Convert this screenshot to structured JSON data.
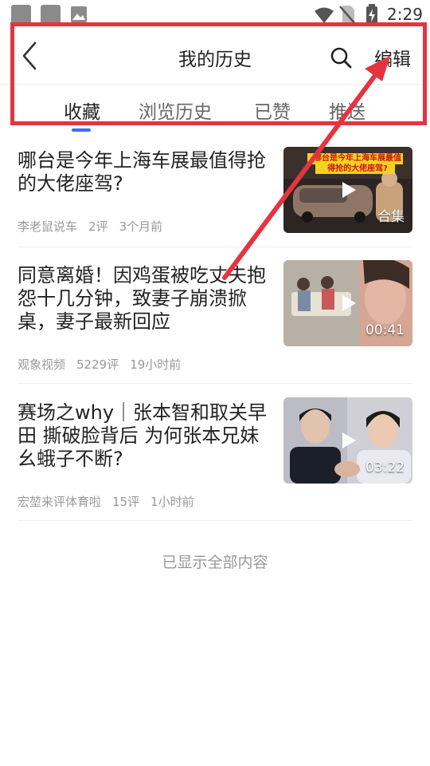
{
  "status_bar": {
    "time": "2:29",
    "icons": [
      "app-icon",
      "app-icon",
      "image-icon",
      "wifi-icon",
      "no-sim-icon",
      "battery-charging-icon"
    ]
  },
  "header": {
    "title": "我的历史",
    "edit_label": "编辑",
    "icons": {
      "back": "chevron-left-icon",
      "search": "search-icon"
    }
  },
  "tabs": [
    {
      "label": "收藏",
      "active": true
    },
    {
      "label": "浏览历史",
      "active": false
    },
    {
      "label": "已赞",
      "active": false
    },
    {
      "label": "推送",
      "active": false
    }
  ],
  "items": [
    {
      "title": "哪台是今年上海车展最值得抢的大佬座驾?",
      "source": "李老鼠说车",
      "comments": "2评",
      "time": "3个月前",
      "thumb_badge": "合集",
      "thumb_caption": "哪台是今年上海车展最值得抢的大佬座驾?"
    },
    {
      "title": "同意离婚！因鸡蛋被吃丈夫抱怨十几分钟，致妻子崩溃掀桌，妻子最新回应",
      "source": "观象视频",
      "comments": "5229评",
      "time": "19小时前",
      "thumb_badge": "00:41"
    },
    {
      "title": "赛场之why｜张本智和取关早田 撕破脸背后 为何张本兄妹幺蛾子不断?",
      "source": "宏堃来评体育啦",
      "comments": "15评",
      "time": "1小时前",
      "thumb_badge": "03:22"
    }
  ],
  "footer_note": "已显示全部内容",
  "colors": {
    "accent": "#3b6cf5",
    "annotation": "#e5343f"
  }
}
